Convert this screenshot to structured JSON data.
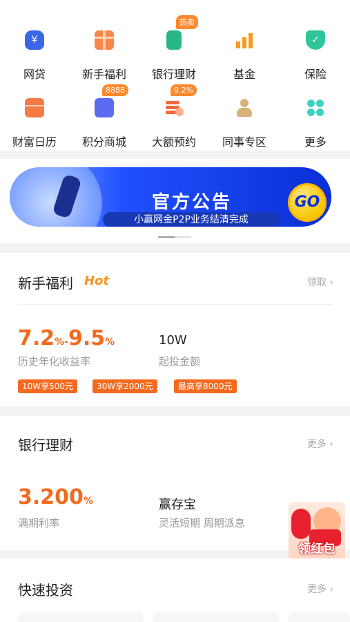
{
  "quick_grid": [
    {
      "label": "网贷",
      "icon": "money-bag-icon",
      "color": "#3a67e8"
    },
    {
      "label": "新手福利",
      "icon": "gift-icon",
      "color": "#f6864a"
    },
    {
      "label": "银行理财",
      "icon": "bank-icon",
      "color": "#29b78a",
      "badge": "热卖"
    },
    {
      "label": "基金",
      "icon": "chart-bar-icon",
      "color": "#f59a23"
    },
    {
      "label": "保险",
      "icon": "shield-icon",
      "color": "#2ec59a"
    },
    {
      "label": "财富日历",
      "icon": "calendar-icon",
      "color": "#f47b45"
    },
    {
      "label": "积分商城",
      "icon": "shopping-bag-icon",
      "color": "#5b6cf0",
      "badge": "8888"
    },
    {
      "label": "大额预约",
      "icon": "coins-icon",
      "color": "#f26b3c",
      "badge": "9.2%"
    },
    {
      "label": "同事专区",
      "icon": "colleague-icon",
      "color": "#d9b27a"
    },
    {
      "label": "更多",
      "icon": "more-grid-icon",
      "color": "#3fcfc0"
    }
  ],
  "banner": {
    "title": "官方公告",
    "subtitle": "小赢网金P2P业务结清完成",
    "go_label": "GO"
  },
  "newbie": {
    "title": "新手福利",
    "hot": "Hot",
    "action": "领取 ›",
    "rate_main": "7.2",
    "rate_sep": "%-",
    "rate_high": "9.5",
    "rate_unit": "%",
    "rate_label": "历史年化收益率",
    "amount": "10W",
    "amount_label": "起投金额",
    "tags": [
      "10W享500元",
      "30W享2000元",
      "最高享8000元"
    ]
  },
  "bank": {
    "title": "银行理财",
    "more": "更多 ›",
    "rate": "3.200",
    "rate_unit": "%",
    "rate_label": "满期利率",
    "product": "赢存宝",
    "product_desc": "灵活短期 周期派息"
  },
  "hongbao": {
    "label": "领红包"
  },
  "quick_invest": {
    "title": "快速投资",
    "more": "更多 ›"
  }
}
